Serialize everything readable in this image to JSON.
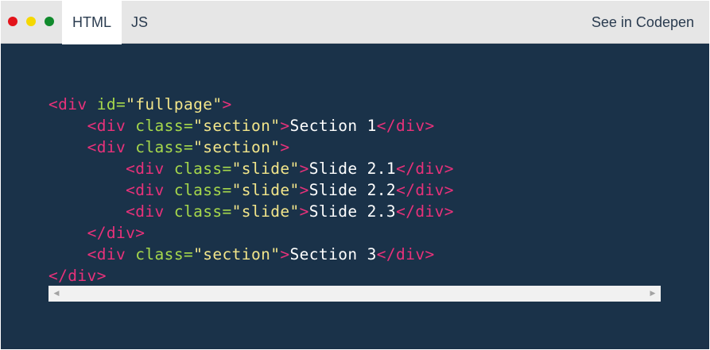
{
  "window": {
    "traffic_lights": [
      {
        "name": "close",
        "color": "#e3141b"
      },
      {
        "name": "minimize",
        "color": "#f5d800"
      },
      {
        "name": "maximize",
        "color": "#108a2c"
      }
    ]
  },
  "tabs": [
    {
      "label": "HTML",
      "active": true
    },
    {
      "label": "JS",
      "active": false
    }
  ],
  "codepen_link": "See in Codepen",
  "colors": {
    "tag": "#e8317a",
    "attribute": "#a6d84b",
    "string": "#f2e58a",
    "text": "#ffffff",
    "background": "#1a3249"
  },
  "code_lines": [
    {
      "indent": "",
      "tokens": [
        {
          "t": "tag",
          "v": "<div "
        },
        {
          "t": "attr",
          "v": "id="
        },
        {
          "t": "str",
          "v": "\"fullpage\""
        },
        {
          "t": "tag",
          "v": ">"
        }
      ]
    },
    {
      "indent": "    ",
      "tokens": [
        {
          "t": "tag",
          "v": "<div "
        },
        {
          "t": "attr",
          "v": "class="
        },
        {
          "t": "str",
          "v": "\"section\""
        },
        {
          "t": "tag",
          "v": ">"
        },
        {
          "t": "txt",
          "v": "Section 1"
        },
        {
          "t": "tag",
          "v": "</div>"
        }
      ]
    },
    {
      "indent": "    ",
      "tokens": [
        {
          "t": "tag",
          "v": "<div "
        },
        {
          "t": "attr",
          "v": "class="
        },
        {
          "t": "str",
          "v": "\"section\""
        },
        {
          "t": "tag",
          "v": ">"
        }
      ]
    },
    {
      "indent": "        ",
      "tokens": [
        {
          "t": "tag",
          "v": "<div "
        },
        {
          "t": "attr",
          "v": "class="
        },
        {
          "t": "str",
          "v": "\"slide\""
        },
        {
          "t": "tag",
          "v": ">"
        },
        {
          "t": "txt",
          "v": "Slide 2.1"
        },
        {
          "t": "tag",
          "v": "</div>"
        }
      ]
    },
    {
      "indent": "        ",
      "tokens": [
        {
          "t": "tag",
          "v": "<div "
        },
        {
          "t": "attr",
          "v": "class="
        },
        {
          "t": "str",
          "v": "\"slide\""
        },
        {
          "t": "tag",
          "v": ">"
        },
        {
          "t": "txt",
          "v": "Slide 2.2"
        },
        {
          "t": "tag",
          "v": "</div>"
        }
      ]
    },
    {
      "indent": "        ",
      "tokens": [
        {
          "t": "tag",
          "v": "<div "
        },
        {
          "t": "attr",
          "v": "class="
        },
        {
          "t": "str",
          "v": "\"slide\""
        },
        {
          "t": "tag",
          "v": ">"
        },
        {
          "t": "txt",
          "v": "Slide 2.3"
        },
        {
          "t": "tag",
          "v": "</div>"
        }
      ]
    },
    {
      "indent": "    ",
      "tokens": [
        {
          "t": "tag",
          "v": "</div>"
        }
      ]
    },
    {
      "indent": "    ",
      "tokens": [
        {
          "t": "tag",
          "v": "<div "
        },
        {
          "t": "attr",
          "v": "class="
        },
        {
          "t": "str",
          "v": "\"section\""
        },
        {
          "t": "tag",
          "v": ">"
        },
        {
          "t": "txt",
          "v": "Section 3"
        },
        {
          "t": "tag",
          "v": "</div>"
        }
      ]
    },
    {
      "indent": "",
      "tokens": [
        {
          "t": "tag",
          "v": "</div>"
        }
      ]
    }
  ],
  "scrollbar": {
    "left_arrow_icon": "triangle-left-icon",
    "right_arrow_icon": "triangle-right-icon",
    "left_arrow_glyph": "◀",
    "right_arrow_glyph": "▶"
  }
}
